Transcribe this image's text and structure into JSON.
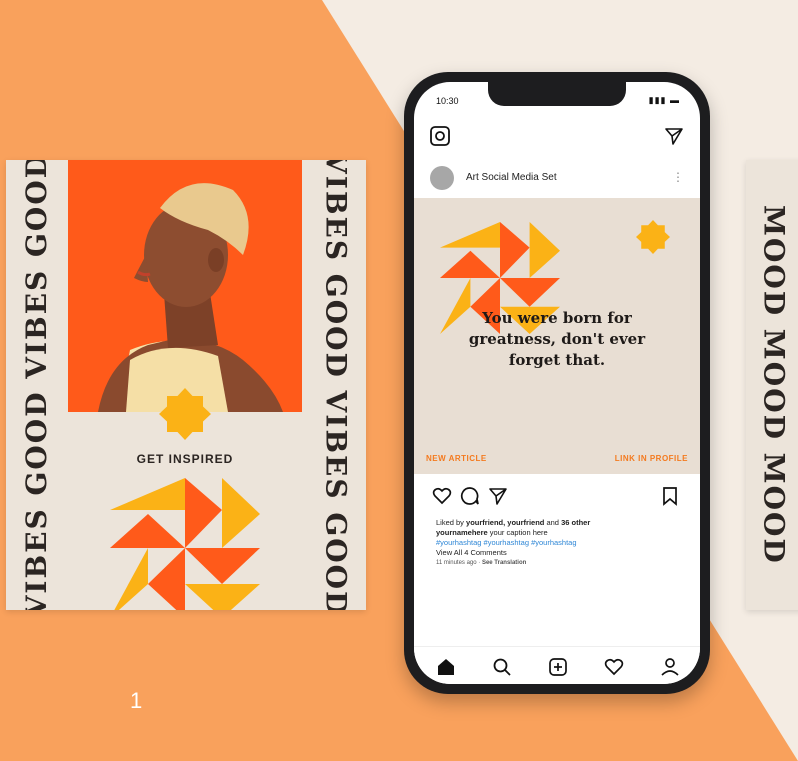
{
  "colors": {
    "orange_bg": "#f9a15c",
    "cream_bg": "#f4ece3",
    "accent_orange": "#ff5a1a",
    "yellow": "#fbb216",
    "link_blue": "#2f87d6"
  },
  "left_card": {
    "vertical_left": "VIBES GOOD VIBES GOOD",
    "vertical_right": "VIBES GOOD VIBES GOOD",
    "cta": "GET INSPIRED"
  },
  "right_card": {
    "vertical": "MOOD MOOD MOOD"
  },
  "phone": {
    "status_time": "10:30",
    "status_icons": "▮▮▮ ▬",
    "account_name": "Art Social Media Set",
    "more": "⋮",
    "post": {
      "quote": "You were born for greatness, don't ever forget that.",
      "left_label": "NEW ARTICLE",
      "right_label": "LINK IN PROFILE"
    },
    "caption": {
      "likes_prefix": "Liked by ",
      "likes_users": "yourfriend, yourfriend",
      "likes_and": " and ",
      "likes_others": "36 other",
      "username": "yournamehere",
      "caption_text": " your caption here",
      "hashtags": "#yourhashtag #yourhashtag #yourhashtag",
      "comments": "View All 4 Comments",
      "time": "11 minutes ago",
      "translation": "See Translation"
    },
    "icons": {
      "top": [
        "camera-icon",
        "send-icon"
      ],
      "actions": [
        "heart-icon",
        "comment-icon",
        "send-icon",
        "bookmark-icon"
      ],
      "nav": [
        "home-icon",
        "search-icon",
        "add-icon",
        "heart-icon",
        "profile-icon"
      ]
    }
  },
  "page_number": "1"
}
